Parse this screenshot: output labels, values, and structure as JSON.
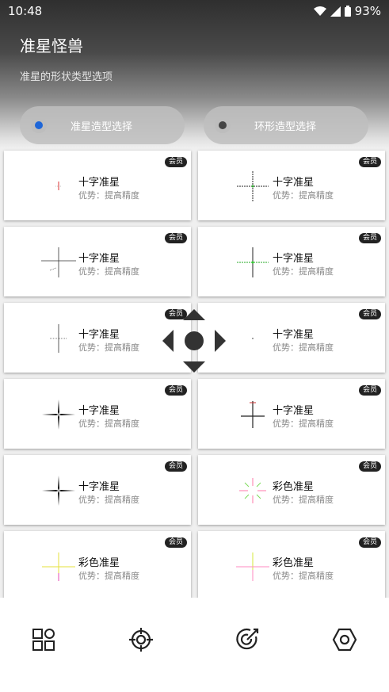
{
  "status": {
    "time": "10:48",
    "battery": "93%"
  },
  "header": {
    "title": "准星怪兽",
    "subtitle": "准星的形状类型选项"
  },
  "options": [
    {
      "label": "准星造型选择",
      "active": true
    },
    {
      "label": "环形造型选择",
      "active": false
    }
  ],
  "cards": [
    {
      "name": "十字准星",
      "adv": "优势：提高精度",
      "badge": "会员"
    },
    {
      "name": "十字准星",
      "adv": "优势：提高精度",
      "badge": "会员"
    },
    {
      "name": "十字准星",
      "adv": "优势：提高精度",
      "badge": "会员"
    },
    {
      "name": "十字准星",
      "adv": "优势：提高精度",
      "badge": "会员"
    },
    {
      "name": "十字准星",
      "adv": "优势：提高精度",
      "badge": "会员"
    },
    {
      "name": "十字准星",
      "adv": "优势：提高精度",
      "badge": "会员"
    },
    {
      "name": "十字准星",
      "adv": "优势：提高精度",
      "badge": "会员"
    },
    {
      "name": "十字准星",
      "adv": "优势：提高精度",
      "badge": "会员"
    },
    {
      "name": "十字准星",
      "adv": "优势：提高精度",
      "badge": "会员"
    },
    {
      "name": "彩色准星",
      "adv": "优势：提高精度",
      "badge": "会员"
    },
    {
      "name": "彩色准星",
      "adv": "优势：提高精度",
      "badge": "会员"
    },
    {
      "name": "彩色准星",
      "adv": "优势：提高精度",
      "badge": "会员"
    }
  ],
  "nav": [
    {
      "icon": "grid-apps-icon"
    },
    {
      "icon": "crosshair-icon"
    },
    {
      "icon": "target-icon"
    },
    {
      "icon": "hexagon-settings-icon"
    }
  ],
  "colors": {
    "accent": "#1e66d8",
    "badge": "#222222"
  }
}
